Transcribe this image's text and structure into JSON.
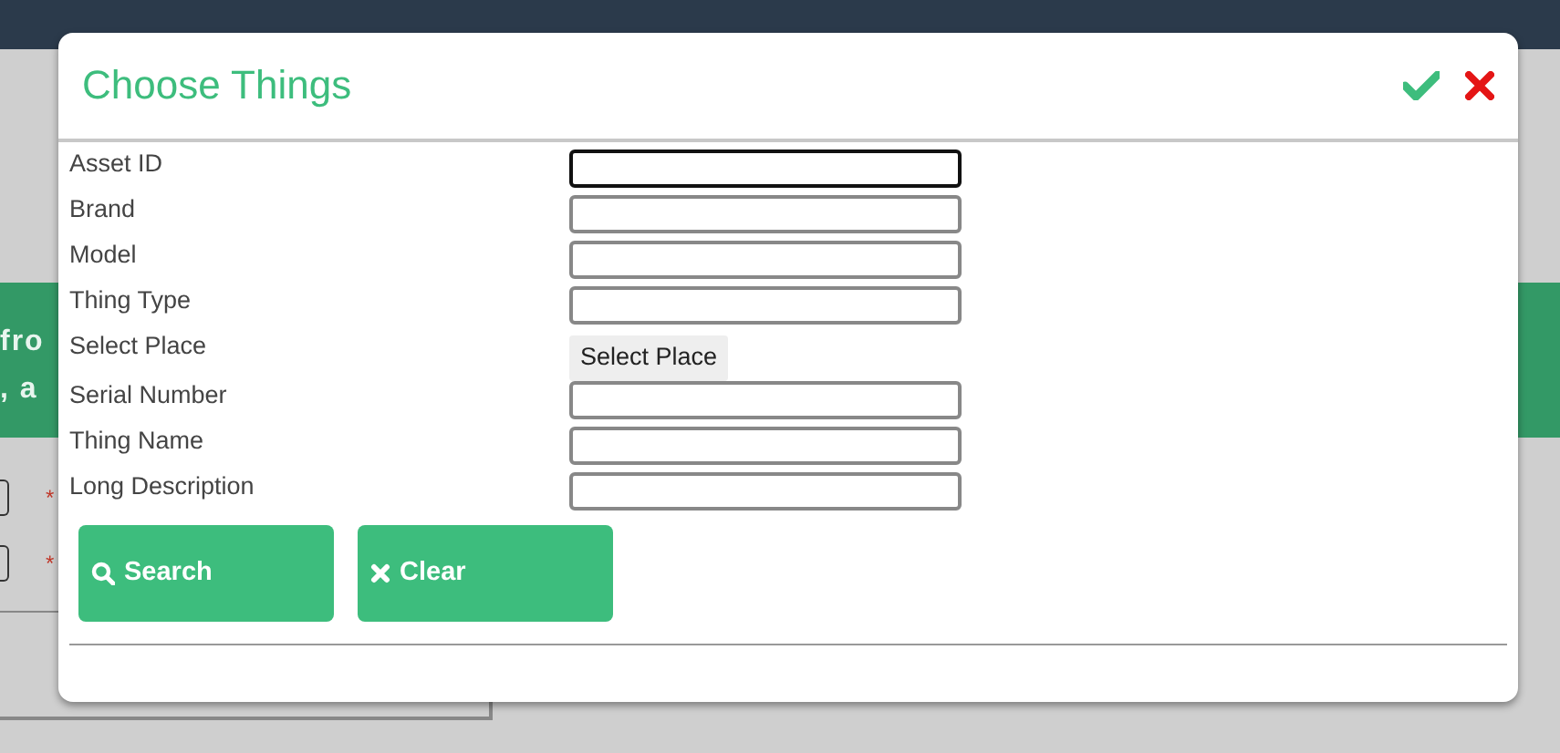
{
  "background": {
    "banner_lines": [
      "fro",
      ", a"
    ],
    "required_marks": [
      "*",
      "*"
    ]
  },
  "dialog": {
    "title": "Choose Things",
    "fields": [
      {
        "label": "Asset ID",
        "kind": "input",
        "focused": true
      },
      {
        "label": "Brand",
        "kind": "input",
        "focused": false
      },
      {
        "label": "Model",
        "kind": "input",
        "focused": false
      },
      {
        "label": "Thing Type",
        "kind": "input",
        "focused": false
      },
      {
        "label": "Select Place",
        "kind": "button",
        "button_label": "Select Place"
      },
      {
        "label": "Serial Number",
        "kind": "input",
        "focused": false
      },
      {
        "label": "Thing Name",
        "kind": "input",
        "focused": false
      },
      {
        "label": "Long Description",
        "kind": "input",
        "focused": false
      }
    ],
    "buttons": [
      {
        "label": "Search",
        "kind": "search"
      },
      {
        "label": "Clear",
        "kind": "clear"
      }
    ]
  }
}
